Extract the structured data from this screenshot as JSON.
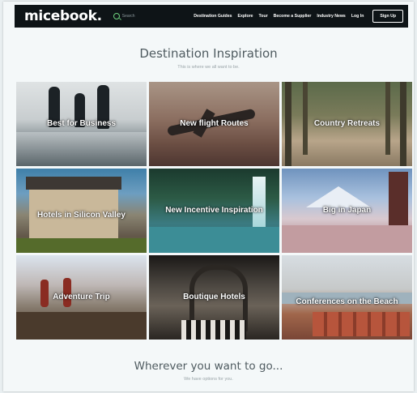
{
  "nav": {
    "logo": "micebook.",
    "search_label": "Search",
    "links": [
      "Destination Guides",
      "Explore",
      "Tour",
      "Become a Supplier",
      "Industry News",
      "Log In"
    ],
    "signup": "Sign Up"
  },
  "hero": {
    "title": "Destination Inspiration",
    "subtitle": "This is where we all want to be."
  },
  "tiles": [
    {
      "label": "Best for Business"
    },
    {
      "label": "New flight Routes"
    },
    {
      "label": "Country Retreats"
    },
    {
      "label": "Hotels in Silicon Valley"
    },
    {
      "label": "New Incentive Inspiration"
    },
    {
      "label": "Big in Japan"
    },
    {
      "label": "Adventure Trip"
    },
    {
      "label": "Boutique Hotels"
    },
    {
      "label": "Conferences on the Beach"
    }
  ],
  "footer": {
    "title": "Wherever you want to go...",
    "subtitle": "We have options for you."
  }
}
